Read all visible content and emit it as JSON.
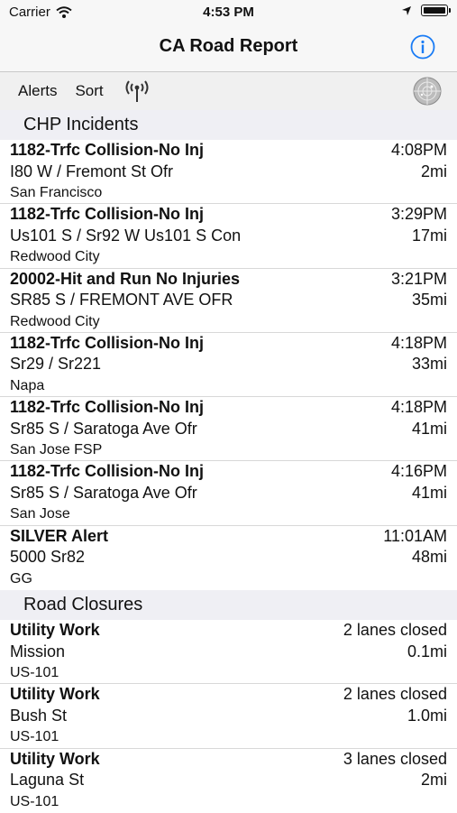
{
  "status_bar": {
    "carrier": "Carrier",
    "time": "4:53 PM"
  },
  "nav": {
    "title": "CA Road Report"
  },
  "toolbar": {
    "alerts_label": "Alerts",
    "sort_label": "Sort"
  },
  "sections": {
    "chp": {
      "header": "CHP Incidents",
      "items": [
        {
          "title": "1182-Trfc Collision-No Inj",
          "time": "4:08PM",
          "road": "I80 W / Fremont St Ofr",
          "distance": "2mi",
          "location": "San Francisco"
        },
        {
          "title": "1182-Trfc Collision-No Inj",
          "time": "3:29PM",
          "road": "Us101 S / Sr92 W Us101 S Con",
          "distance": "17mi",
          "location": "Redwood City"
        },
        {
          "title": "20002-Hit and Run No Injuries",
          "time": "3:21PM",
          "road": "SR85 S / FREMONT AVE OFR",
          "distance": "35mi",
          "location": "Redwood City"
        },
        {
          "title": "1182-Trfc Collision-No Inj",
          "time": "4:18PM",
          "road": "Sr29 / Sr221",
          "distance": "33mi",
          "location": "Napa"
        },
        {
          "title": "1182-Trfc Collision-No Inj",
          "time": "4:18PM",
          "road": "Sr85 S / Saratoga Ave Ofr",
          "distance": "41mi",
          "location": "San Jose FSP"
        },
        {
          "title": "1182-Trfc Collision-No Inj",
          "time": "4:16PM",
          "road": "Sr85 S / Saratoga Ave Ofr",
          "distance": "41mi",
          "location": "San Jose"
        },
        {
          "title": "SILVER Alert",
          "time": "11:01AM",
          "road": "5000 Sr82",
          "distance": "48mi",
          "location": "GG"
        }
      ]
    },
    "closures": {
      "header": "Road Closures",
      "items": [
        {
          "title": "Utility Work",
          "status": "2 lanes closed",
          "road": "Mission",
          "distance": "0.1mi",
          "route": "US-101"
        },
        {
          "title": "Utility Work",
          "status": "2 lanes closed",
          "road": "Bush St",
          "distance": "1.0mi",
          "route": "US-101"
        },
        {
          "title": "Utility Work",
          "status": "3 lanes closed",
          "road": "Laguna St",
          "distance": "2mi",
          "route": "US-101"
        }
      ]
    }
  }
}
